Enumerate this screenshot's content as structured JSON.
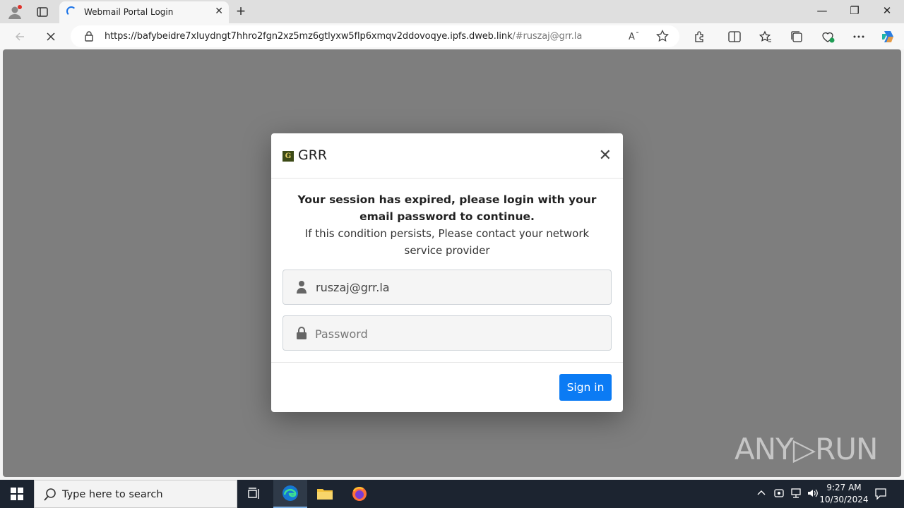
{
  "browser": {
    "tab_title": "Webmail Portal Login",
    "url_host": "https://bafybeidre7xluydngt7hhro2fgn2xz5mz6gtlyxw5flp6xmqv2ddovoqye.ipfs.dweb.link",
    "url_fragment": "/#ruszaj@grr.la",
    "win_min": "—",
    "win_max": "❐",
    "win_close": "✕",
    "new_tab": "+"
  },
  "modal": {
    "brand": "GRR",
    "logo_letter": "G",
    "close": "✕",
    "message_bold": "Your session has expired, please login with your email password to continue.",
    "message": "If this condition persists, Please contact your network service provider",
    "email_value": "ruszaj@grr.la",
    "password_placeholder": "Password",
    "signin_label": "Sign in"
  },
  "watermark": "ANY▷RUN",
  "taskbar": {
    "search_placeholder": "Type here to search",
    "time": "9:27 AM",
    "date": "10/30/2024"
  },
  "colors": {
    "accent": "#0b7bf4",
    "overlay": "#7e7e7e",
    "taskbar": "#1c2430"
  }
}
